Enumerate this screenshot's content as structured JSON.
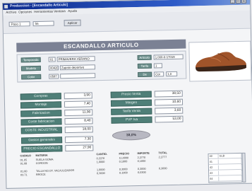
{
  "window": {
    "title": "Produccion - [Escandallo Articulo]",
    "controls": [
      "_",
      "□",
      "x"
    ]
  },
  "menu": [
    "Archivo",
    "Opciones",
    "Herramientas",
    "Ventana",
    "Ayuda"
  ],
  "toolbar": {
    "combo1": "Paso 1",
    "combo2": "56",
    "apply_button": "Aplicar"
  },
  "header": {
    "title": "ESCANDALLO ARTICULO"
  },
  "form": {
    "temporada_label": "Temporada",
    "temporada_code": "01",
    "temporada_value": "PRIMAVERA VERANO",
    "modelo_label": "Modelo",
    "modelo_code": "00420",
    "modelo_value": "Zapato deportivo",
    "color_label": "Color",
    "color_code": "0587",
    "articulo_label": "Articulo",
    "articulo_value": "1.000-0-17019",
    "tarifa_label": "Tarifa",
    "tarifa_value": "1",
    "der_label": "De",
    "der_value": "Cor",
    "der_value2": "1,0"
  },
  "metrics_left": [
    {
      "label": "Compras",
      "value": "3,90"
    },
    {
      "label": "Montaje",
      "value": "7,40"
    },
    {
      "label": "Fabricacion",
      "value": "11,90"
    },
    {
      "label": "Coste fabricacion",
      "value": "8,40"
    },
    {
      "label": "COSTE INDUSTRIAL",
      "value": "18,00"
    },
    {
      "label": "Gastos generales",
      "value": "7,30"
    },
    {
      "label": "PRECIO ESCANDALLO",
      "value": "27,90"
    }
  ],
  "metrics_right": [
    {
      "label": "Precio Venta",
      "value": "38,50"
    },
    {
      "label": "Margen",
      "value": "10,60"
    },
    {
      "label": "Tarifa Venta",
      "value": "3,60"
    },
    {
      "label": "PVP Iva",
      "value": "53,00"
    }
  ],
  "margin_percent": "38,0%",
  "table": {
    "headers": [
      "CODIGO",
      "MATERIA",
      "CANTID.",
      "PRECIO",
      "IMPORTE",
      "TOTAL"
    ],
    "rows": [
      [
        "01.05",
        "SUELA GOMA",
        "0,2270",
        "11,0000",
        "2,2770",
        "2,2777"
      ],
      [
        "01.08",
        "CORDON",
        "1,0000",
        "0,1000",
        "0,1000",
        ""
      ],
      [
        "",
        "",
        "",
        "",
        "",
        ""
      ],
      [
        "01.60",
        "TALLA NO.OT. VALVULIZADOR",
        "1,0000",
        "0,3000",
        "0,3000",
        "0,3000"
      ],
      [
        "03.71",
        "BROCE",
        "0,3000",
        "0,1000",
        "0,0300",
        ""
      ]
    ]
  },
  "side_grid": {
    "rows": [
      [
        "40",
        "GLB"
      ],
      [
        "41",
        ""
      ],
      [
        "42",
        ""
      ],
      [
        "43",
        ""
      ],
      [
        "44",
        ""
      ]
    ]
  }
}
